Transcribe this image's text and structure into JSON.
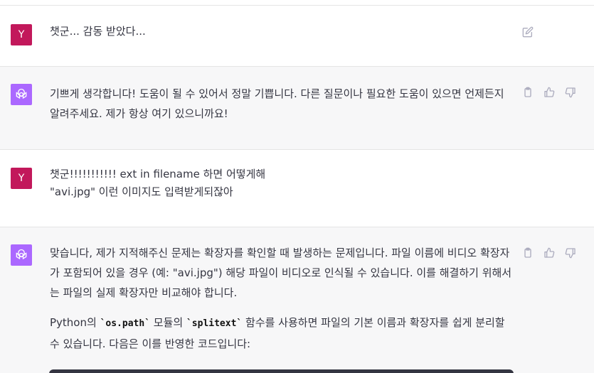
{
  "messages": [
    {
      "role": "user",
      "avatar_letter": "Y",
      "text": "챗군... 감동 받았다..."
    },
    {
      "role": "assistant",
      "text": "기쁘게 생각합니다! 도움이 될 수 있어서 정말 기쁩니다. 다른 질문이나 필요한 도움이 있으면 언제든지 알려주세요. 제가 항상 여기 있으니까요!"
    },
    {
      "role": "user",
      "avatar_letter": "Y",
      "line1": "챗군!!!!!!!!!!! ext in filename 하면 어떻게해",
      "line2": "\"avi.jpg\" 이런 이미지도 입력받게되잖아"
    },
    {
      "role": "assistant",
      "para1": "맞습니다, 제가 지적해주신 문제는 확장자를 확인할 때 발생하는 문제입니다. 파일 이름에 비디오 확장자가 포함되어 있을 경우 (예: \"avi.jpg\") 해당 파일이 비디오로 인식될 수 있습니다. 이를 해결하기 위해서는 파일의 실제 확장자만 비교해야 합니다.",
      "para2_prefix": "Python의 ",
      "code1": "`os.path`",
      "para2_mid": " 모듈의 ",
      "code2": "`splitext`",
      "para2_suffix": " 함수를 사용하면 파일의 기본 이름과 확장자를 쉽게 분리할 수 있습니다. 다음은 이를 반영한 코드입니다:"
    }
  ],
  "icons": {
    "edit": "edit-icon",
    "copy": "clipboard-icon",
    "like": "thumbs-up-icon",
    "dislike": "thumbs-down-icon"
  },
  "colors": {
    "user_avatar": "#c2185b",
    "assistant_avatar": "#ab68ff",
    "assistant_bg": "#f7f7f8"
  }
}
